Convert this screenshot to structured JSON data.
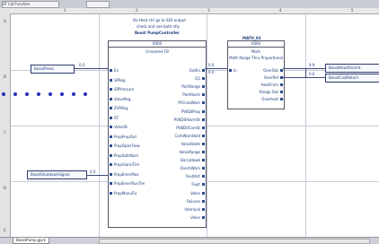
{
  "toolbar": {
    "field1": "ST Lib  Function",
    "field2": ""
  },
  "ruler": {
    "left": [
      "A",
      "B",
      "C",
      "D",
      "E"
    ],
    "top": [
      "1",
      "2",
      "3",
      "4",
      "5"
    ]
  },
  "notes": {
    "line1": "Do Heat ctrl  go to SES output",
    "line2": "check and see both ntly"
  },
  "fb_main": {
    "instance": "Boost PumpController",
    "badge": "0000",
    "type": "Unnamed FB",
    "inputs": [
      "En",
      "SPReg",
      "SPPressure",
      "ValveReg",
      "ZVAReg",
      "ST",
      "ValveSt",
      "PropPropOut",
      "PropOpenFlow",
      "PropSafeNum",
      "PropAlarmTim",
      "PropEmerMax",
      "PropEmerRunTim",
      "PropManuFix"
    ],
    "outputs": [
      "OutEn",
      "Q1",
      "PortRange",
      "PortAlarm",
      "PVCreaWarn",
      "PVBDIProp",
      "PVBD0AlarmSt",
      "PVBD0ComSt",
      "ComWarnHold",
      "ValveState",
      "ValveRange",
      "BarryHawk",
      "OverhWarn",
      "FaultAct",
      "Fault",
      "Valve",
      "Failures",
      "Interlock",
      "Valve"
    ]
  },
  "fb_math": {
    "instance": "MATH_03",
    "badge": "0000",
    "type": "Math",
    "desc": "Math Range Thru Proportional",
    "inputs": [
      "In"
    ],
    "outputs": [
      "OverOut",
      "OverRef",
      "HeatFrom",
      "Range Out",
      "Overheat"
    ]
  },
  "variables": {
    "left_top": "BoostPress",
    "left_bottom": "BoostShutdownSignal",
    "right_top": "BoostHeadOverrd",
    "right_bottom": "BoostCoolReturn"
  },
  "wire_labels": {
    "w1": "0.0",
    "w2": "0.0",
    "w3": "0.0",
    "w4": "0.0",
    "w5": "9.9",
    "w6": "0.0"
  },
  "sheet_tab": "BoostPump.gprk"
}
